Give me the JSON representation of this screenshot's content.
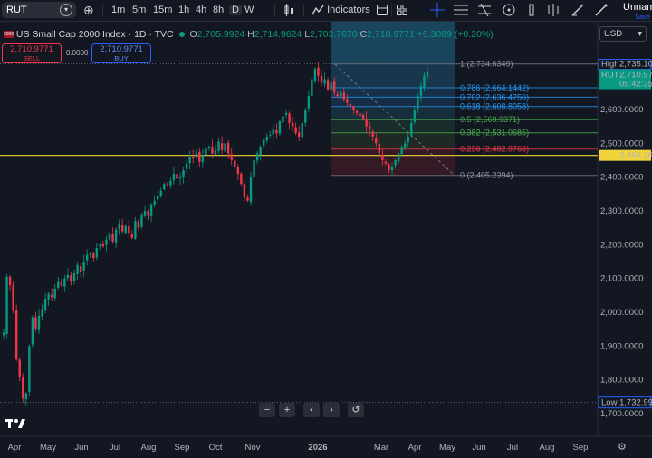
{
  "toolbar": {
    "symbol": "RUT",
    "timeframes": [
      "1m",
      "5m",
      "15m",
      "1h",
      "4h",
      "8h",
      "D",
      "W"
    ],
    "selected_timeframe": "D",
    "indicators_label": "Indicators",
    "layout_name": "Unnam",
    "save_label": "Save"
  },
  "legend": {
    "title": "US Small Cap 2000 Index · 1D · TVC",
    "open_label": "O",
    "open": "2,705.9924",
    "high_label": "H",
    "high": "2,714.9624",
    "low_label": "L",
    "low": "2,703.7670",
    "close_label": "C",
    "close": "2,710.9771",
    "change": "+5.3089 (+0.20%)",
    "sell_price": "2,710.9771",
    "sell_label": "SELL",
    "spread": "0.0000",
    "buy_price": "2,710.9771",
    "buy_label": "BUY"
  },
  "currency": "USD",
  "price_axis": {
    "ticks": [
      "2,600.0000",
      "2,500.0000",
      "2,400.0000",
      "2,300.0000",
      "2,200.0000",
      "2,100.0000",
      "2,000.0000",
      "1,900.0000",
      "1,800.0000",
      "1,700.0000"
    ],
    "high_label": "High",
    "high_value": "2,735.1043",
    "last_symbol": "RUT",
    "last_value": "2,710.9771",
    "countdown": "05:42:35",
    "line_value": "2,464.2617",
    "low_label": "Low",
    "low_value": "1,732.9921"
  },
  "time_axis": {
    "ticks": [
      "Apr",
      "May",
      "Jun",
      "Jul",
      "Aug",
      "Sep",
      "Oct",
      "Nov",
      "2026",
      "Mar",
      "Apr",
      "May",
      "Jun",
      "Jul",
      "Aug",
      "Sep"
    ]
  },
  "fib_levels": [
    {
      "label": "1 (2,734.6349)",
      "price": 2734.6349,
      "color": "#787b86"
    },
    {
      "label": "0.786 (2,664.1442)",
      "price": 2664.1442,
      "color": "#2196f3"
    },
    {
      "label": "0.702 (2,636.4750)",
      "price": 2636.475,
      "color": "#2196f3"
    },
    {
      "label": "0.618 (2,608.8058)",
      "price": 2608.8058,
      "color": "#2196f3"
    },
    {
      "label": "0.5 (2,569.9371)",
      "price": 2569.9371,
      "color": "#4caf50"
    },
    {
      "label": "0.382 (2,531.0685)",
      "price": 2531.0685,
      "color": "#4caf50"
    },
    {
      "label": "0.236 (2,482.9768)",
      "price": 2482.9768,
      "color": "#f23645"
    },
    {
      "label": "0 (2,405.2394)",
      "price": 2405.2394,
      "color": "#787b86"
    }
  ],
  "horizontal_line_price": 2464.2617,
  "price_path": [
    1940,
    2105,
    2080,
    2005,
    1860,
    1810,
    1745,
    1760,
    1900,
    1985,
    1950,
    1990,
    2010,
    2040,
    2055,
    2045,
    2070,
    2090,
    2080,
    2100,
    2110,
    2090,
    2115,
    2140,
    2120,
    2150,
    2170,
    2175,
    2160,
    2190,
    2200,
    2195,
    2215,
    2230,
    2210,
    2245,
    2260,
    2240,
    2255,
    2235,
    2220,
    2270,
    2250,
    2290,
    2300,
    2285,
    2320,
    2330,
    2345,
    2360,
    2380,
    2375,
    2390,
    2410,
    2395,
    2400,
    2420,
    2440,
    2460,
    2455,
    2470,
    2445,
    2465,
    2485,
    2490,
    2470,
    2480,
    2505,
    2480,
    2500,
    2470,
    2450,
    2430,
    2410,
    2380,
    2340,
    2330,
    2400,
    2450,
    2470,
    2490,
    2510,
    2520,
    2525,
    2540,
    2530,
    2565,
    2580,
    2590,
    2560,
    2550,
    2530,
    2520,
    2560,
    2600,
    2640,
    2690,
    2720,
    2700,
    2680,
    2690,
    2660,
    2680,
    2650,
    2640,
    2650,
    2630,
    2620,
    2610,
    2600,
    2590,
    2580,
    2570,
    2550,
    2540,
    2520,
    2500,
    2470,
    2450,
    2440,
    2420,
    2430,
    2450,
    2470,
    2490,
    2500,
    2520,
    2560,
    2600,
    2640,
    2670,
    2700,
    2711
  ]
}
